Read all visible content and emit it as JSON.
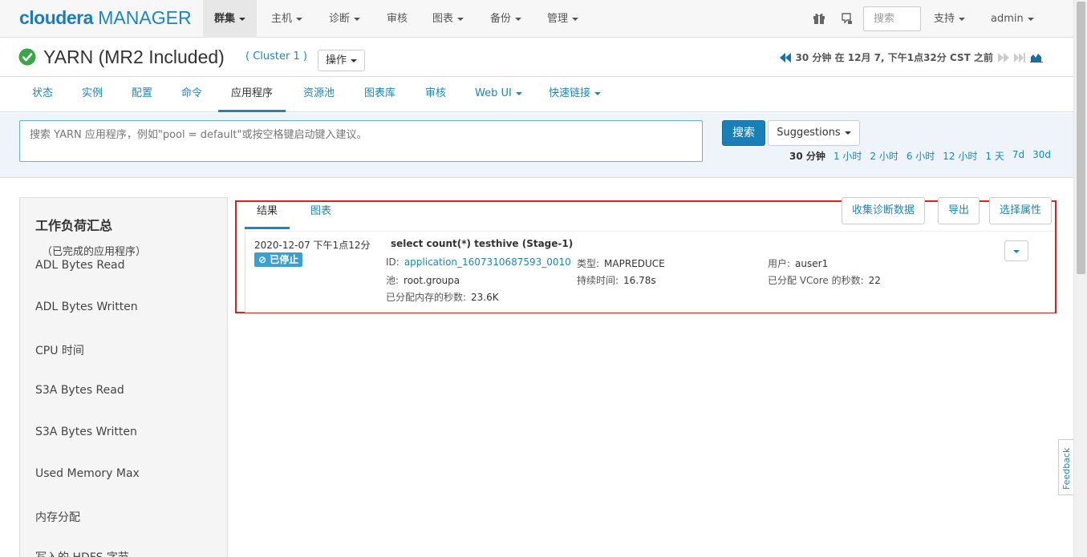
{
  "brand": {
    "name_bold": "cloudera",
    "name_rest": "MANAGER"
  },
  "topnav": {
    "items": [
      {
        "label": "群集",
        "caret": true,
        "active": true
      },
      {
        "label": "主机",
        "caret": true
      },
      {
        "label": "诊断",
        "caret": true
      },
      {
        "label": "审核",
        "caret": false
      },
      {
        "label": "图表",
        "caret": true
      },
      {
        "label": "备份",
        "caret": true
      },
      {
        "label": "管理",
        "caret": true
      }
    ],
    "search_placeholder": "搜索",
    "support_label": "支持",
    "user_label": "admin"
  },
  "service": {
    "title": "YARN (MR2 Included)",
    "cluster": "( Cluster 1 )",
    "ops_label": "操作",
    "time_label": "30 分钟 在 12月 7, 下午1点32分 CST 之前"
  },
  "subtabs": [
    "状态",
    "实例",
    "配置",
    "命令",
    "应用程序",
    "资源池",
    "图表库",
    "审核",
    "Web UI",
    "快速链接"
  ],
  "query": {
    "placeholder": "搜索 YARN 应用程序，例如\"pool = default\"或按空格键启动键入建议。",
    "search_label": "搜索",
    "suggestions_label": "Suggestions",
    "ranges": [
      "30 分钟",
      "1 小时",
      "2 小时",
      "6 小时",
      "12 小时",
      "1 天",
      "7d",
      "30d"
    ]
  },
  "workload": {
    "title": "工作负荷汇总",
    "subtitle": "（已完成的应用程序）",
    "items": [
      "ADL Bytes Read",
      "ADL Bytes Written",
      "CPU 时间",
      "S3A Bytes Read",
      "S3A Bytes Written",
      "Used Memory Max",
      "内存分配",
      "写入的 HDFS 字节"
    ]
  },
  "results": {
    "tabs": [
      "结果",
      "图表"
    ],
    "actions": [
      "收集诊断数据",
      "导出",
      "选择属性"
    ],
    "app": {
      "time": "2020-12-07 下午1点12分",
      "status": "已停止",
      "name": "select count(*) testhive (Stage-1)",
      "id_label": "ID:",
      "id_value": "application_1607310687593_0010",
      "type_label": "类型:",
      "type_value": "MAPREDUCE",
      "user_label": "用户:",
      "user_value": "auser1",
      "pool_label": "池:",
      "pool_value": "root.groupa",
      "duration_label": "持续时间:",
      "duration_value": "16.78s",
      "vcore_label": "已分配 VCore 的秒数:",
      "vcore_value": "22",
      "mem_label": "已分配内存的秒数:",
      "mem_value": "23.6K"
    }
  },
  "feedback_label": "Feedback",
  "colors": {
    "accent": "#1a86bd",
    "highlight_border": "#e0201c",
    "ok": "#3aa648"
  }
}
